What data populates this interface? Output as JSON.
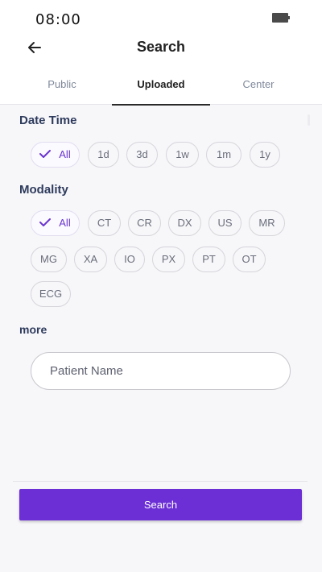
{
  "status_bar": {
    "time": "08:00"
  },
  "header": {
    "title": "Search"
  },
  "tabs": [
    {
      "label": "Public"
    },
    {
      "label": "Uploaded",
      "active": true
    },
    {
      "label": "Center"
    }
  ],
  "date_time": {
    "label": "Date Time",
    "selected": "All",
    "options": [
      "All",
      "1d",
      "3d",
      "1w",
      "1m",
      "1y"
    ]
  },
  "modality": {
    "label": "Modality",
    "selected": "All",
    "options": [
      "All",
      "CT",
      "CR",
      "DX",
      "US",
      "MR",
      "MG",
      "XA",
      "IO",
      "PX",
      "PT",
      "OT",
      "ECG"
    ]
  },
  "more": {
    "label": "more"
  },
  "patient_name": {
    "placeholder": "Patient Name",
    "value": ""
  },
  "actions": {
    "search_label": "Search"
  },
  "colors": {
    "accent": "#6c2ed5",
    "selected_chip_text": "#6a35cf",
    "section_label": "#2e3b5c"
  },
  "icons": {
    "back": "arrow-left-icon",
    "battery": "battery-icon",
    "check": "check-icon"
  }
}
